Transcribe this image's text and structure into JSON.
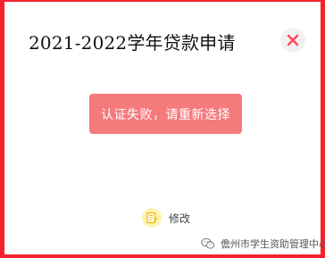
{
  "dialog": {
    "title": "2021-2022学年贷款申请",
    "close_icon": "close-icon",
    "alert_message": "认证失败，请重新选择",
    "edit_label": "修改",
    "edit_icon": "edit-note-icon"
  },
  "watermark": {
    "text": "儋州市学生资助管理中心",
    "icon": "wechat-icon"
  },
  "colors": {
    "border": "#f5222d",
    "close_x": "#ff4d5a",
    "alert_bg": "#f57a7c"
  }
}
